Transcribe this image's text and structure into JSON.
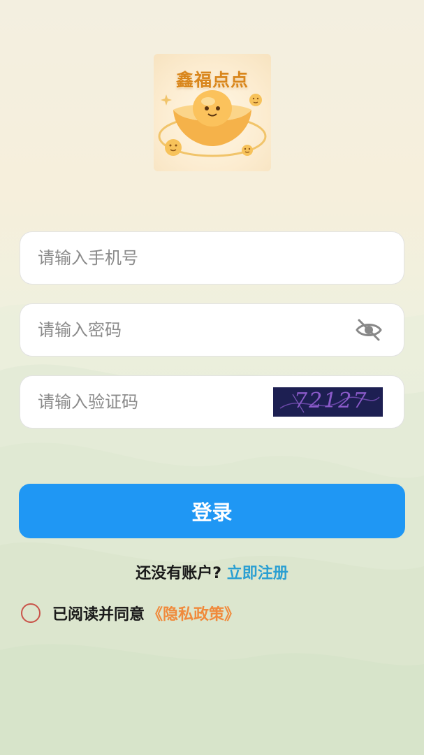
{
  "logo": {
    "title": "鑫福点点"
  },
  "form": {
    "phone_placeholder": "请输入手机号",
    "password_placeholder": "请输入密码",
    "code_placeholder": "请输入验证码",
    "captcha_text": "72127"
  },
  "login_button": "登录",
  "register": {
    "prompt": "还没有账户?",
    "link": "立即注册"
  },
  "agreement": {
    "text": "已阅读并同意",
    "policy": "《隐私政策》"
  },
  "colors": {
    "primary": "#1f97f4",
    "link": "#2a9fd2",
    "policy": "#f08a3c",
    "radio_border": "#c9544a"
  },
  "icons": {
    "password_toggle": "eye-off-icon"
  }
}
